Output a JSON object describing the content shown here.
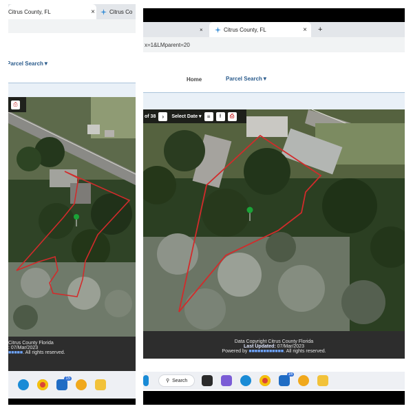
{
  "left": {
    "tabs": [
      {
        "title": "Citrus County, FL",
        "close": "×"
      },
      {
        "title": "Citrus Co"
      }
    ],
    "nav": {
      "parcel_search": "Parcel Search▼"
    },
    "footer": {
      "line1": "Citrus County Florida",
      "line2": ": 07/Mar/2023",
      "line3": ". All rights reserved."
    },
    "taskbar": {
      "badge": "15"
    }
  },
  "right": {
    "tabs": [
      {
        "close_left": "×"
      },
      {
        "title": "Citrus County, FL",
        "close": "×",
        "new": "+"
      }
    ],
    "url": "x=1&LMparent=20",
    "nav": {
      "home": "Home",
      "parcel_search": "Parcel Search▼"
    },
    "map_toolbar": {
      "page": "of 38",
      "select_date": "Select Date ▾"
    },
    "footer": {
      "line1": "Data Copyright Citrus County Florida",
      "line2_label": "Last Updated:",
      "line2_value": "07/Mar/2023",
      "line3_prefix": "Powered by",
      "line3_suffix": ". All rights reserved."
    },
    "taskbar": {
      "search": "Search",
      "badge": "16"
    }
  },
  "colors": {
    "parcel_outline": "#d22b2b",
    "marker": "#1aa337",
    "link": "#2a5b8c",
    "footer_bg": "#2d2d2d"
  }
}
